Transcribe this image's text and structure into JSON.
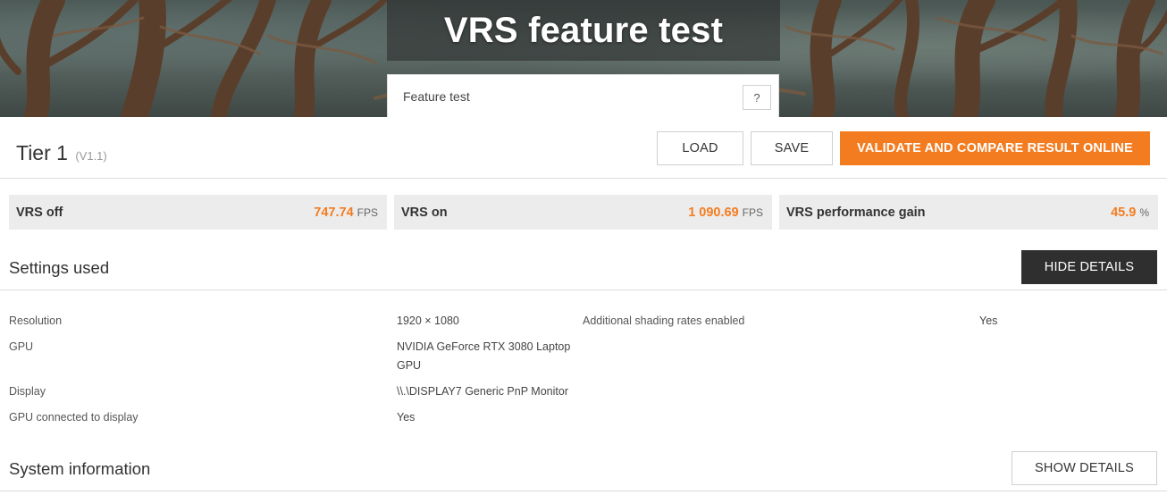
{
  "header": {
    "title": "VRS feature test",
    "feature_select_label": "Feature test",
    "help_label": "?"
  },
  "result": {
    "tier_label": "Tier 1",
    "version": "(V1.1)"
  },
  "toolbar": {
    "load_label": "LOAD",
    "save_label": "SAVE",
    "validate_label": "VALIDATE AND COMPARE RESULT ONLINE"
  },
  "scores": [
    {
      "name": "VRS off",
      "value": "747.74",
      "unit": "FPS"
    },
    {
      "name": "VRS on",
      "value": "1 090.69",
      "unit": "FPS"
    },
    {
      "name": "VRS performance gain",
      "value": "45.9",
      "unit": "%"
    }
  ],
  "settings": {
    "title": "Settings used",
    "toggle_label": "HIDE DETAILS",
    "rows": [
      {
        "key": "Resolution",
        "value": "1920 × 1080"
      },
      {
        "key": "GPU",
        "value": "NVIDIA GeForce RTX 3080 Laptop GPU"
      },
      {
        "key": "Display",
        "value": "\\\\.\\DISPLAY7 Generic PnP Monitor"
      },
      {
        "key": "GPU connected to display",
        "value": "Yes"
      }
    ],
    "extra": {
      "key": "Additional shading rates enabled",
      "value": "Yes"
    }
  },
  "system": {
    "title": "System information",
    "toggle_label": "SHOW DETAILS"
  },
  "colors": {
    "accent": "#f47c20",
    "dark_button": "#2f2f2f",
    "card_bg": "#ececec"
  }
}
